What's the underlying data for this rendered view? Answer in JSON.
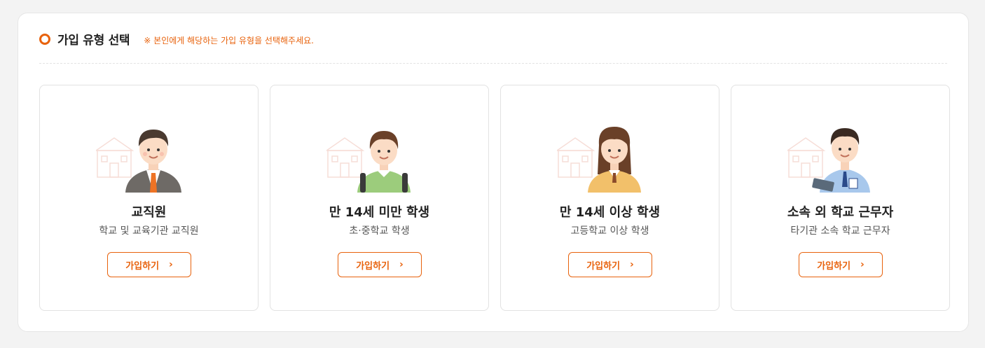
{
  "section": {
    "title": "가입 유형 선택",
    "note": "※ 본인에게 해당하는 가입 유형을 선택해주세요."
  },
  "cards": [
    {
      "title": "교직원",
      "desc": "학교 및 교육기관 교직원",
      "button": "가입하기",
      "icon": "teacher-icon"
    },
    {
      "title": "만 14세 미만 학생",
      "desc": "초·중학교 학생",
      "button": "가입하기",
      "icon": "young-student-icon"
    },
    {
      "title": "만 14세 이상 학생",
      "desc": "고등학교 이상 학생",
      "button": "가입하기",
      "icon": "older-student-icon"
    },
    {
      "title": "소속 외 학교 근무자",
      "desc": "타기관 소속 학교 근무자",
      "button": "가입하기",
      "icon": "external-worker-icon"
    }
  ],
  "colors": {
    "accent": "#e8620c",
    "text": "#222222",
    "muted": "#555555",
    "border": "#e2e2e2"
  }
}
